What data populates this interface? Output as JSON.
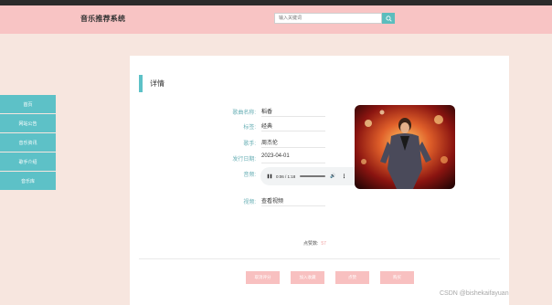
{
  "header": {
    "brand": "音乐推荐系统",
    "search_placeholder": "输入关键词"
  },
  "sidebar": {
    "items": [
      {
        "label": "首页"
      },
      {
        "label": "网站公告"
      },
      {
        "label": "音乐资讯"
      },
      {
        "label": "歌手介绍"
      },
      {
        "label": "音乐库"
      }
    ]
  },
  "detail": {
    "section_title": "详情",
    "fields": [
      {
        "label": "歌曲名称:",
        "value": "稻香"
      },
      {
        "label": "标签:",
        "value": "经典"
      },
      {
        "label": "歌手:",
        "value": "周杰伦"
      },
      {
        "label": "发行日期:",
        "value": "2023-04-01"
      },
      {
        "label": "音频:",
        "value": ""
      },
      {
        "label": "视频:",
        "value": "查看视频"
      }
    ],
    "audio": {
      "time": "0:06 / 1:18",
      "state": "playing"
    },
    "likes_label": "点赞数:",
    "likes_value": "57"
  },
  "actions": {
    "items": [
      {
        "label": "取消评分"
      },
      {
        "label": "加入收藏"
      },
      {
        "label": "点赞"
      },
      {
        "label": "购买"
      }
    ]
  },
  "watermark": "CSDN @bishekaifayuan",
  "colors": {
    "header": "#f8c4c4",
    "accent": "#5dc1c7",
    "button": "#f8c0c0",
    "page_bg": "#f7e6df"
  }
}
